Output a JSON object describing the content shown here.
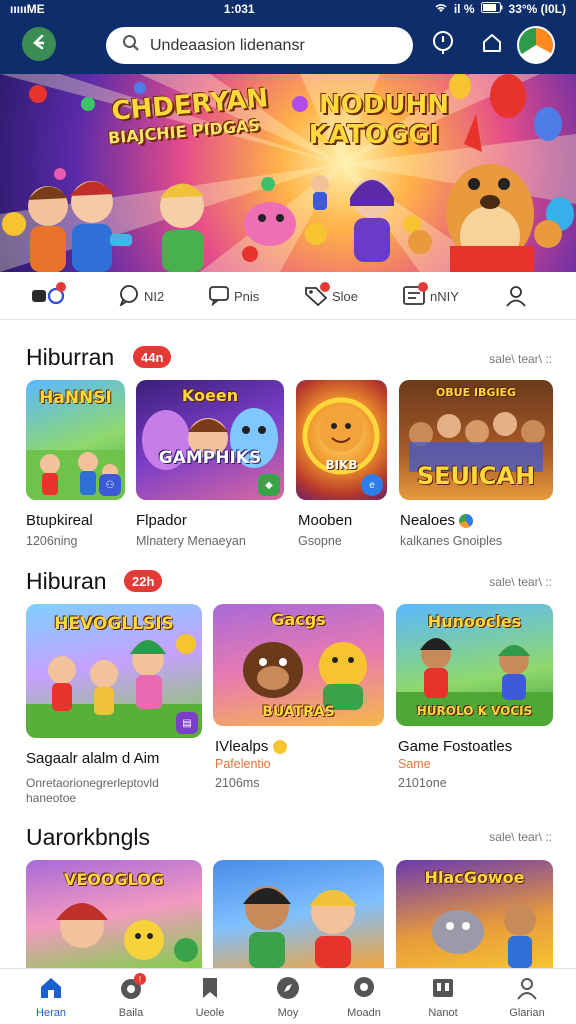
{
  "status_bar": {
    "carrier": "ıııııME",
    "time": "1:031",
    "battery": "33°% (I0L)",
    "signal_pct": "il %"
  },
  "header": {
    "search_placeholder": "Undeaasion lidenansr",
    "icons": [
      "back-icon",
      "search-icon",
      "location-pin-icon",
      "home-icon",
      "avatar-flag-icon"
    ]
  },
  "hero": {
    "title_left_1": "CHDERYAN",
    "title_left_2": "BIAJCHIE PIDGAS",
    "title_right_1": "NODUHN",
    "title_right_2": "KATOGGI"
  },
  "categories": [
    {
      "label": "",
      "icon": "games-icon",
      "badge": true
    },
    {
      "label": "NI2",
      "icon": "chat-icon",
      "badge": false
    },
    {
      "label": "Pnis",
      "icon": "message-icon",
      "badge": false
    },
    {
      "label": "Sloe",
      "icon": "tag-icon",
      "badge": true
    },
    {
      "label": "nNIY",
      "icon": "list-icon",
      "badge": true
    },
    {
      "label": "",
      "icon": "profile-icon",
      "badge": false
    }
  ],
  "sections": [
    {
      "title": "Hiburran",
      "pill": "44n",
      "see_all": "sale\\ tear\\ ::",
      "cards": [
        {
          "title": "Btupkireal",
          "sub": "1206ning",
          "thumb_text": "HaNNSI"
        },
        {
          "title": "Flpador",
          "sub": "Mlnatery Menaeyan",
          "thumb_text": "GAMPHIKS"
        },
        {
          "title": "Mooben",
          "sub": "Gsopne",
          "thumb_text": "BIKB"
        },
        {
          "title": "Nealoes",
          "sub": "kalkanes Gnoiples",
          "thumb_text": "SEUICAH"
        }
      ]
    },
    {
      "title": "Hiburan",
      "pill": "22h",
      "see_all": "sale\\ tear\\ ::",
      "cards": [
        {
          "title": "Sagaalr alalm d Aim",
          "sub": "Onretaorionegrerleptovld",
          "sub2": "haneotoe",
          "thumb_text": "HEVOGLLSIS"
        },
        {
          "title": "IVlealps",
          "sub": "Pafelentio",
          "sub2": "2106ms",
          "thumb_text": "BUATRAS"
        },
        {
          "title": "Game Fostoatles",
          "sub": "Same",
          "sub2": "2101one",
          "thumb_text": "HUROLO K VOCIS"
        }
      ]
    },
    {
      "title": "Uarorkbngls",
      "see_all": "sale\\ tear\\ ::",
      "cards": [
        {
          "thumb_text": "VEOOGLOG"
        },
        {
          "thumb_text": ""
        },
        {
          "thumb_text": "HlacGowoe"
        }
      ]
    }
  ],
  "bottom_nav": [
    {
      "label": "Heran",
      "icon": "home-icon",
      "active": true
    },
    {
      "label": "Baila",
      "icon": "gamepad-icon",
      "badge": true
    },
    {
      "label": "Ueole",
      "icon": "bookmark-icon"
    },
    {
      "label": "Moy",
      "icon": "compass-icon"
    },
    {
      "label": "Moadn",
      "icon": "chat-bubble-icon"
    },
    {
      "label": "Nanot",
      "icon": "library-icon"
    },
    {
      "label": "Glarian",
      "icon": "profile-icon"
    }
  ],
  "colors": {
    "header": "#0d2d6b",
    "accent": "#e53935",
    "active_nav": "#1a5fd1"
  }
}
